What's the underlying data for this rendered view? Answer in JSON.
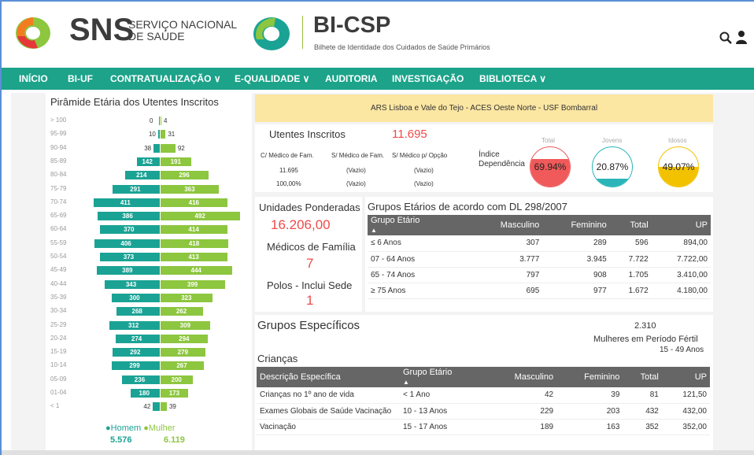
{
  "header": {
    "sns_word": "SNS",
    "sns_sub_line1": "SERVIÇO NACIONAL",
    "sns_sub_line2": "DE SAÚDE",
    "bi_title": "BI-CSP",
    "bi_subtitle": "Bilhete de Identidade dos Cuidados de Saúde Primários",
    "icons": [
      "search-icon",
      "user-icon"
    ]
  },
  "nav": {
    "items": [
      "INÍCIO",
      "BI-UF",
      "CONTRATUALIZAÇÃO ∨",
      "E-QUALIDADE ∨",
      "AUDITORIA",
      "INVESTIGAÇÃO",
      "BIBLIOTECA ∨"
    ]
  },
  "pyramid": {
    "title": "Pirâmide Etária dos Utentes Inscritos",
    "legend_homem": "●Homem",
    "legend_mulher": "●Mulher",
    "total_homem": "5.576",
    "total_mulher": "6.119",
    "colors": {
      "homem": "#1aa395",
      "mulher": "#8dc63f"
    }
  },
  "chart_data": {
    "type": "bar",
    "title": "Pirâmide Etária dos Utentes Inscritos",
    "categories": [
      "> 100",
      "95-99",
      "90-94",
      "85-89",
      "80-84",
      "75-79",
      "70-74",
      "65-69",
      "60-64",
      "55-59",
      "50-54",
      "45-49",
      "40-44",
      "35-39",
      "30-34",
      "25-29",
      "20-24",
      "15-19",
      "10-14",
      "05-09",
      "01-04",
      "< 1"
    ],
    "series": [
      {
        "name": "Homem",
        "values": [
          0,
          10,
          38,
          142,
          214,
          291,
          411,
          386,
          370,
          406,
          373,
          389,
          343,
          300,
          268,
          312,
          274,
          292,
          299,
          236,
          180,
          42
        ]
      },
      {
        "name": "Mulher",
        "values": [
          4,
          31,
          92,
          191,
          296,
          363,
          416,
          492,
          414,
          418,
          413,
          444,
          399,
          323,
          262,
          309,
          294,
          279,
          267,
          200,
          173,
          39
        ]
      }
    ]
  },
  "banner": {
    "text": "ARS Lisboa e Vale do Tejo - ACES Oeste Norte - USF Bombarral"
  },
  "utentes": {
    "label": "Utentes Inscritos",
    "value": "11.695",
    "col1_header": "C/ Médico de Fam.",
    "col2_header": "S/ Médico de Fam.",
    "col3_header": "S/ Médico p/ Opção",
    "col1_v1": "11.695",
    "col1_v2": "100,00%",
    "col2_v1": "(Vazio)",
    "col2_v2": "(Vazio)",
    "col3_v1": "(Vazio)",
    "col3_v2": "(Vazio)"
  },
  "dependencia": {
    "label_line1": "Índice",
    "label_line2": "Dependência",
    "gauges": [
      {
        "caption": "Total",
        "value": "69.94%",
        "level": 0.6994,
        "color": "#f05a5a"
      },
      {
        "caption": "Jovens",
        "value": "20.87%",
        "level": 0.2087,
        "color": "#2bb5b8"
      },
      {
        "caption": "Idosos",
        "value": "49.07%",
        "level": 0.4907,
        "color": "#f2c200"
      }
    ]
  },
  "kpis": {
    "up_label": "Unidades Ponderadas",
    "up_value": "16.206,00",
    "mf_label": "Médicos de Família",
    "mf_value": "7",
    "polos_label": "Polos - Inclui Sede",
    "polos_value": "1"
  },
  "grupos_etarios": {
    "title": "Grupos Etários de acordo com DL 298/2007",
    "headers": [
      "Grupo Etário",
      "Masculino",
      "Feminino",
      "Total",
      "UP"
    ],
    "rows": [
      [
        "≤ 6 Anos",
        "307",
        "289",
        "596",
        "894,00"
      ],
      [
        "07 - 64 Anos",
        "3.777",
        "3.945",
        "7.722",
        "7.722,00"
      ],
      [
        "65 - 74 Anos",
        "797",
        "908",
        "1.705",
        "3.410,00"
      ],
      [
        "≥ 75 Anos",
        "695",
        "977",
        "1.672",
        "4.180,00"
      ]
    ]
  },
  "grupos_especificos": {
    "title": "Grupos Específicos",
    "mulheres_value": "2.310",
    "mulheres_label": "Mulheres em Período Fértil",
    "mulheres_range": "15 - 49 Anos",
    "criancas_title": "Crianças",
    "headers": [
      "Descrição Específica",
      "Grupo Etário",
      "Masculino",
      "Feminino",
      "Total",
      "UP"
    ],
    "rows": [
      [
        "Crianças no 1º ano de vida",
        "< 1 Ano",
        "42",
        "39",
        "81",
        "121,50"
      ],
      [
        "Exames Globais de Saúde Vacinação",
        "10 - 13 Anos",
        "229",
        "203",
        "432",
        "432,00"
      ],
      [
        "Vacinação",
        "15 - 17 Anos",
        "189",
        "163",
        "352",
        "352,00"
      ]
    ]
  }
}
